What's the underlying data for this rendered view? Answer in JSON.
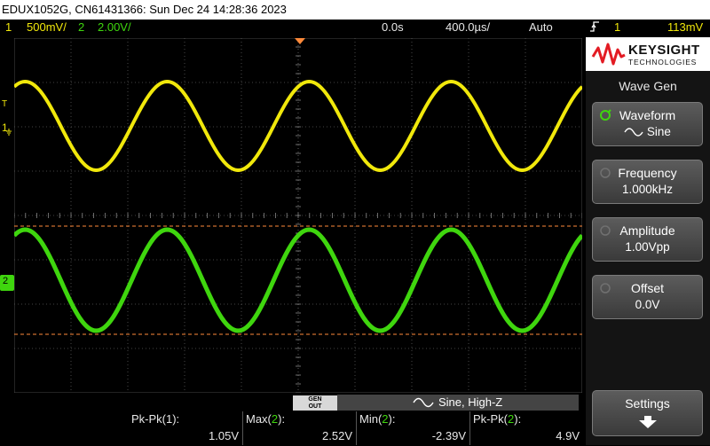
{
  "title": "EDUX1052G, CN61431366: Sun Dec 24 14:28:36 2023",
  "status": {
    "ch1_num": "1",
    "ch1_scale": "500mV/",
    "ch2_num": "2",
    "ch2_scale": "2.00V/",
    "delay": "0.0s",
    "timebase": "400.0µs/",
    "trigger_mode": "Auto",
    "trigger_icon": "rising-edge-icon",
    "trigger_source": "1",
    "trigger_level": "113mV"
  },
  "markers": {
    "trigger": "T",
    "ch1": "1",
    "ch2": "2"
  },
  "logo": {
    "brand": "KEYSIGHT",
    "sub": "TECHNOLOGIES"
  },
  "menu": {
    "title": "Wave Gen",
    "keys": [
      {
        "label": "Waveform",
        "value": "Sine",
        "active": true
      },
      {
        "label": "Frequency",
        "value": "1.000kHz",
        "active": false
      },
      {
        "label": "Amplitude",
        "value": "1.00Vpp",
        "active": false
      },
      {
        "label": "Offset",
        "value": "0.0V",
        "active": false
      }
    ],
    "settings": "Settings"
  },
  "gen": {
    "out_line1": "GEN",
    "out_line2": "OUT",
    "status": "Sine, High-Z"
  },
  "measurements": [
    {
      "label": "Pk-Pk(1):",
      "value": "1.05V"
    },
    {
      "label": "Max(2):",
      "value": "2.52V"
    },
    {
      "label": "Min(2):",
      "value": "-2.39V"
    },
    {
      "label": "Pk-Pk(2):",
      "value": "4.9V"
    }
  ],
  "colors": {
    "ch1": "#f1e80b",
    "ch2": "#3fd60e",
    "cursor": "#ff8a3a",
    "grid": "#5a5a5a"
  }
}
